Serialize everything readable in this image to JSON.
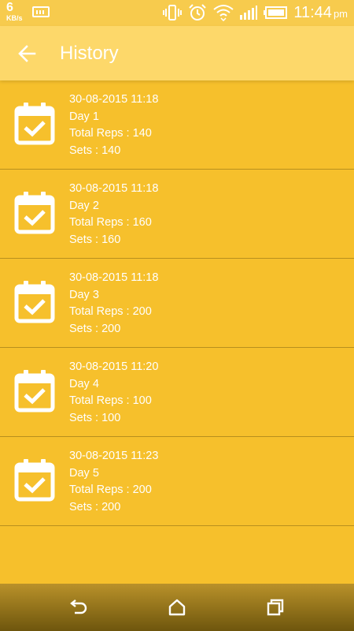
{
  "status_bar": {
    "speed_value": "6",
    "speed_unit": "KB/s",
    "time": "11:44",
    "ampm": "pm",
    "icons": [
      "keyboard-icon",
      "vibrate-icon",
      "alarm-icon",
      "wifi-icon",
      "signal-icon",
      "battery-icon"
    ]
  },
  "app_bar": {
    "title": "History",
    "back_icon": "arrow-left-icon"
  },
  "history": [
    {
      "date": "30-08-2015 11:18",
      "day": "Day 1",
      "reps": "Total Reps : 140",
      "sets": "Sets : 140"
    },
    {
      "date": "30-08-2015 11:18",
      "day": "Day 2",
      "reps": "Total Reps : 160",
      "sets": "Sets : 160"
    },
    {
      "date": "30-08-2015 11:18",
      "day": "Day 3",
      "reps": "Total Reps : 200",
      "sets": "Sets : 200"
    },
    {
      "date": "30-08-2015 11:20",
      "day": "Day 4",
      "reps": "Total Reps : 100",
      "sets": "Sets : 100"
    },
    {
      "date": "30-08-2015 11:23",
      "day": "Day 5",
      "reps": "Total Reps : 200",
      "sets": "Sets : 200"
    }
  ],
  "nav_bar": {
    "icons": [
      "back-nav-icon",
      "home-nav-icon",
      "recents-nav-icon"
    ]
  },
  "colors": {
    "background": "#f6c02c",
    "app_bar": "#fdd86a",
    "status_bar": "#f7cb4d",
    "text": "#ffffff"
  }
}
